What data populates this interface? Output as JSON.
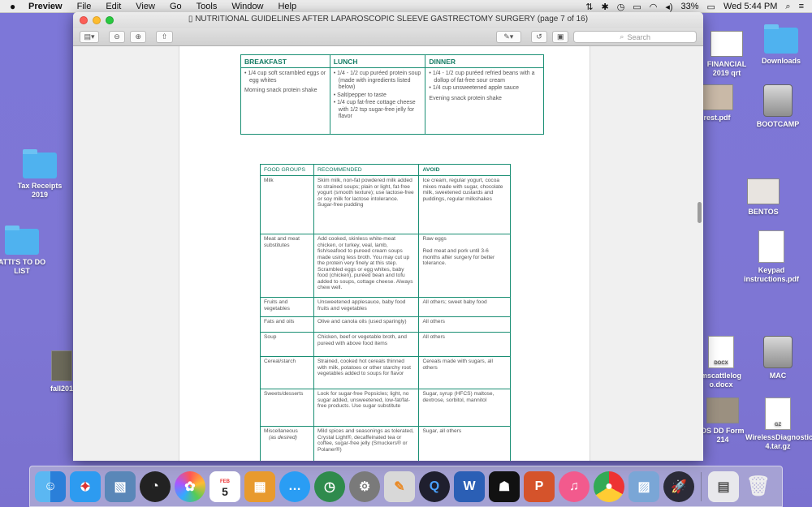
{
  "menubar": {
    "apple": "",
    "app": "Preview",
    "items": [
      "File",
      "Edit",
      "View",
      "Go",
      "Tools",
      "Window",
      "Help"
    ],
    "battery": "33%",
    "clock": "Wed 5:44 PM"
  },
  "desktop": {
    "left_icons": [
      "Tax Receipts 2019",
      "ATTI'S TO DO LIST",
      "fall201"
    ],
    "right_labels": [
      "FINANCIAL\n2019 qrt",
      "rest.pdf",
      "mscattlelog\no.docx",
      "DS DD Form\n214"
    ],
    "right_icons": [
      "Downloads",
      "BOOTCAMP",
      "BENTOS",
      "Keypad instructions.pdf",
      "MAC",
      "WirelessDiagnostics_C0…4.tar.gz"
    ],
    "doc_badges": [
      "DOCX",
      "GZ"
    ]
  },
  "window": {
    "title": "NUTRITIONAL GUIDELINES AFTER LAPAROSCOPIC SLEEVE GASTRECTOMY SURGERY (page 7 of 16)",
    "search_placeholder": "Search"
  },
  "meal_table": {
    "headers": [
      "BREAKFAST",
      "LUNCH",
      "DINNER"
    ],
    "breakfast": {
      "items": [
        "1/4 cup soft scrambled eggs or egg whites"
      ],
      "snack": "Morning snack protein shake"
    },
    "lunch": {
      "items": [
        "1/4 - 1/2 cup puréed protein soup (made with ingredients listed below)",
        "Salt/pepper to taste",
        "1/4 cup fat-free cottage cheese with 1/2 tsp sugar-free jelly for flavor"
      ]
    },
    "dinner": {
      "items": [
        "1/4 - 1/2 cup puréed refried beans with a dollop of fat-free sour cream",
        "1/4 cup unsweetened apple sauce"
      ],
      "snack": "Evening snack protein shake"
    }
  },
  "food_table": {
    "headers": [
      "FOOD GROUPS",
      "RECOMMENDED",
      "AVOID"
    ],
    "rows": [
      {
        "group": "Milk",
        "recommended": "Skim milk, non-fat powdered milk added to strained soups; plain or light, fat-free yogurt (smooth texture); use lactose-free or soy milk for lactose intolerance. Sugar-free pudding",
        "avoid": "Ice cream, regular yogurt, cocoa mixes made with sugar, chocolate milk, sweetened custards and puddings, regular milkshakes"
      },
      {
        "group": "Meat and meat substitutes",
        "recommended": "Add cooked, skinless white-meat chicken, or turkey, veal, lamb, fish/seafood to pureed cream soups made using less broth. You may cut up the protein very finely at this step. Scrambled eggs or egg whites, baby food (chicken), puréed bean and tofu added to soups, cottage cheese. Always chew well.",
        "avoid": "Raw eggs\n\nRed meat and pork until 3-6 months after surgery for better tolerance."
      },
      {
        "group": "Fruits and vegetables",
        "recommended": "Unsweetened applesauce, baby food fruits and vegetables",
        "avoid": "All others; sweet baby food"
      },
      {
        "group": "Fats and oils",
        "recommended": "Olive and canola oils (used sparingly)",
        "avoid": "All others"
      },
      {
        "group": "Soup",
        "recommended": "Chicken, beef or vegetable broth, and pureed with above food items",
        "avoid": "All others"
      },
      {
        "group": "Cereal/starch",
        "recommended": "Strained, cooked hot cereals thinned with milk, potatoes or other starchy root vegetables added to soups for flavor",
        "avoid": "Cereals made with sugars, all others"
      },
      {
        "group": "Sweets/desserts",
        "recommended": "Look for sugar-free Popsicles; light, no sugar added, unsweetened, low-fat/fat-free products. Use sugar substitute",
        "avoid": "Sugar, syrup (HFCS) maltose, dextrose, sorbitol, mannitol"
      },
      {
        "group": "Miscellaneous",
        "group_note": "(as desired)",
        "recommended": "Mild spices and seasonings as tolerated, Crystal Light®, decaffeinated tea or coffee, sugar-free jelly (Smuckers® or Polaner®)",
        "avoid": "Sugar, all others"
      }
    ]
  },
  "dock": {
    "items": [
      "finder-icon",
      "safari-icon",
      "preview-icon",
      "dashboard-icon",
      "photos-icon",
      "calendar-icon",
      "calculator-icon",
      "messages-icon",
      "time-machine-icon",
      "system-preferences-icon",
      "pages-icon",
      "quicktime-icon",
      "word-icon",
      "kindle-icon",
      "powerpoint-icon",
      "itunes-icon",
      "chrome-icon",
      "photo-slideshow-icon",
      "launchpad-icon",
      "downloads-stack-icon",
      "trash-icon"
    ],
    "calendar_month": "FEB",
    "calendar_day": "5"
  }
}
